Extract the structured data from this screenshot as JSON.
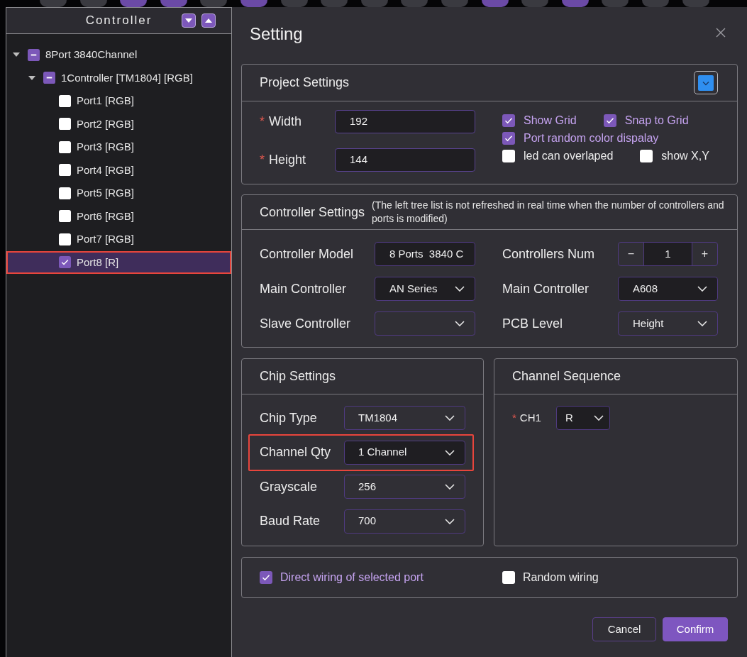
{
  "toolbar": {
    "buttons": [
      {
        "active": false
      },
      {
        "active": false
      },
      {
        "active": true
      },
      {
        "active": true
      },
      {
        "active": false
      },
      {
        "active": true
      },
      {
        "active": false
      },
      {
        "active": false
      },
      {
        "active": false
      },
      {
        "active": false
      },
      {
        "active": false
      },
      {
        "active": true
      },
      {
        "active": false
      },
      {
        "active": true
      },
      {
        "active": false
      },
      {
        "active": false
      },
      {
        "active": false
      }
    ]
  },
  "tree_panel": {
    "title": "Controller",
    "tree": [
      {
        "label": "8Port 3840Channel",
        "expanded": true,
        "checked": false,
        "indeterminate": true,
        "selected": false,
        "highlighted": false,
        "children": [
          {
            "label": "1Controller [TM1804] [RGB]",
            "expanded": true,
            "checked": false,
            "indeterminate": true,
            "selected": false,
            "highlighted": false,
            "children": [
              {
                "label": "Port1 [RGB]",
                "checked": false,
                "selected": false,
                "highlighted": false
              },
              {
                "label": "Port2 [RGB]",
                "checked": false,
                "selected": false,
                "highlighted": false
              },
              {
                "label": "Port3 [RGB]",
                "checked": false,
                "selected": false,
                "highlighted": false
              },
              {
                "label": "Port4 [RGB]",
                "checked": false,
                "selected": false,
                "highlighted": false
              },
              {
                "label": "Port5 [RGB]",
                "checked": false,
                "selected": false,
                "highlighted": false
              },
              {
                "label": "Port6 [RGB]",
                "checked": false,
                "selected": false,
                "highlighted": false
              },
              {
                "label": "Port7 [RGB]",
                "checked": false,
                "selected": false,
                "highlighted": false
              },
              {
                "label": "Port8 [R]",
                "checked": true,
                "selected": true,
                "highlighted": true
              }
            ]
          }
        ]
      }
    ]
  },
  "dialog": {
    "title": "Setting",
    "project_settings": {
      "title": "Project Settings",
      "fields": [
        {
          "label": "Width",
          "required_mark": "*",
          "value": "192"
        },
        {
          "label": "Height",
          "required_mark": "*",
          "value": "144"
        }
      ],
      "options": [
        [
          {
            "label": "Show Grid",
            "checked": true
          },
          {
            "label": "Snap to Grid",
            "checked": true
          }
        ],
        [
          {
            "label": "Port random color dispalay",
            "checked": true
          }
        ],
        [
          {
            "label": "led can overlaped",
            "checked": false
          },
          {
            "label": "show X,Y",
            "checked": false
          }
        ]
      ]
    },
    "controller_settings": {
      "title": "Controller Settings",
      "note": "(The left tree list is not refreshed in real time when the number of controllers and ports is modified)",
      "fields": [
        {
          "kind": "text",
          "label": "Controller Model",
          "value": "8 Ports  3840 C"
        },
        {
          "kind": "stepper",
          "label": "Controllers Num",
          "value": "1",
          "decrement": "−",
          "increment": "+"
        },
        {
          "kind": "select",
          "label": "Main Controller",
          "value": "AN Series",
          "active": true
        },
        {
          "kind": "select",
          "label": "Main Controller",
          "value": "A608",
          "active": true
        },
        {
          "kind": "select",
          "label": "Slave Controller",
          "active": false
        },
        {
          "kind": "select",
          "label": "PCB Level",
          "value": "Height",
          "active": false
        }
      ]
    },
    "chip_settings": {
      "title": "Chip Settings",
      "fields": [
        {
          "label": "Chip Type",
          "value": "TM1804",
          "active": false,
          "highlighted": false
        },
        {
          "label": "Channel Qty",
          "value": "1 Channel",
          "active": true,
          "highlighted": true
        },
        {
          "label": "Grayscale",
          "value": "256",
          "active": false,
          "highlighted": false
        },
        {
          "label": "Baud Rate",
          "value": "700",
          "active": false,
          "highlighted": false
        }
      ]
    },
    "channel_sequence": {
      "title": "Channel Sequence",
      "channels": [
        {
          "label": "CH1",
          "required_mark": "*",
          "value": "R",
          "active": true
        }
      ]
    },
    "wiring": [
      {
        "label": "Direct wiring of selected port",
        "checked": true
      },
      {
        "label": "Random wiring",
        "checked": false
      }
    ],
    "buttons": [
      {
        "label": "Cancel",
        "kind": "secondary"
      },
      {
        "label": "Confirm",
        "kind": "primary"
      }
    ]
  }
}
